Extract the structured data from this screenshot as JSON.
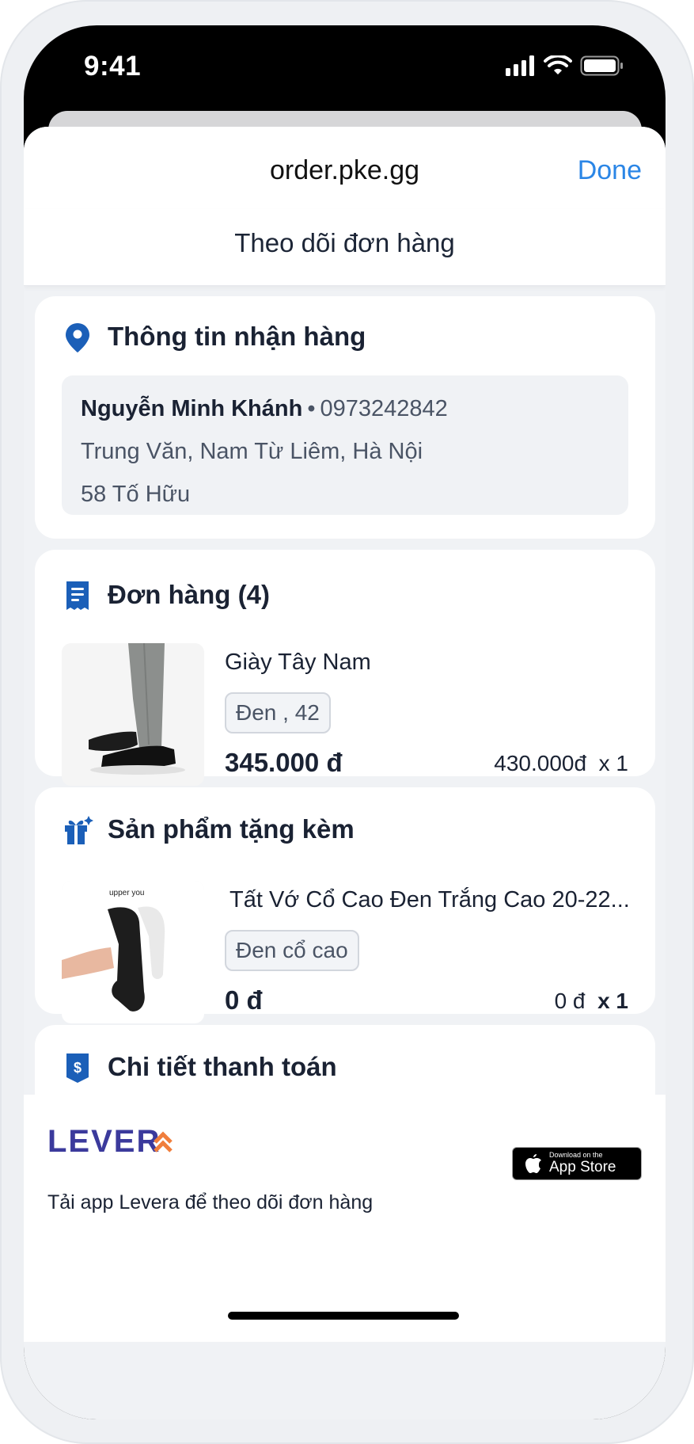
{
  "status_bar": {
    "time": "9:41",
    "icons": [
      "signal-icon",
      "wifi-icon",
      "battery-icon"
    ]
  },
  "browser": {
    "url": "order.pke.gg",
    "done_label": "Done"
  },
  "page": {
    "title": "Theo dõi đơn hàng"
  },
  "shipping": {
    "title": "Thông tin nhận hàng",
    "name": "Nguyễn Minh Khánh",
    "separator": "•",
    "phone": "0973242842",
    "area": "Trung Văn, Nam Từ Liêm, Hà Nội",
    "street": "58 Tố Hữu"
  },
  "order": {
    "title": "Đơn hàng (4)",
    "item": {
      "name": "Giày Tây Nam",
      "variant": "Đen , 42",
      "price": "345.000 đ",
      "unit_price": "430.000đ",
      "qty": "x  1"
    }
  },
  "gift": {
    "title": "Sản phẩm tặng kèm",
    "item": {
      "brand_text": "upper you",
      "name": "Tất Vớ Cổ Cao Đen Trắng Cao 20-22...",
      "variant": "Đen cổ cao",
      "price": "0 đ",
      "unit_price": "0 đ",
      "qty": "x  1"
    }
  },
  "payment": {
    "title": "Chi tiết thanh toán"
  },
  "promo": {
    "logo_text": "LEVERA",
    "text": "Tải app Levera để theo dõi đơn hàng",
    "appstore_small": "Download on the",
    "appstore_big": "App Store"
  },
  "colors": {
    "accent": "#2b86e6",
    "icon_blue": "#1b5fb8",
    "logo_purple": "#3b3a9c",
    "logo_orange": "#f07e3c"
  }
}
